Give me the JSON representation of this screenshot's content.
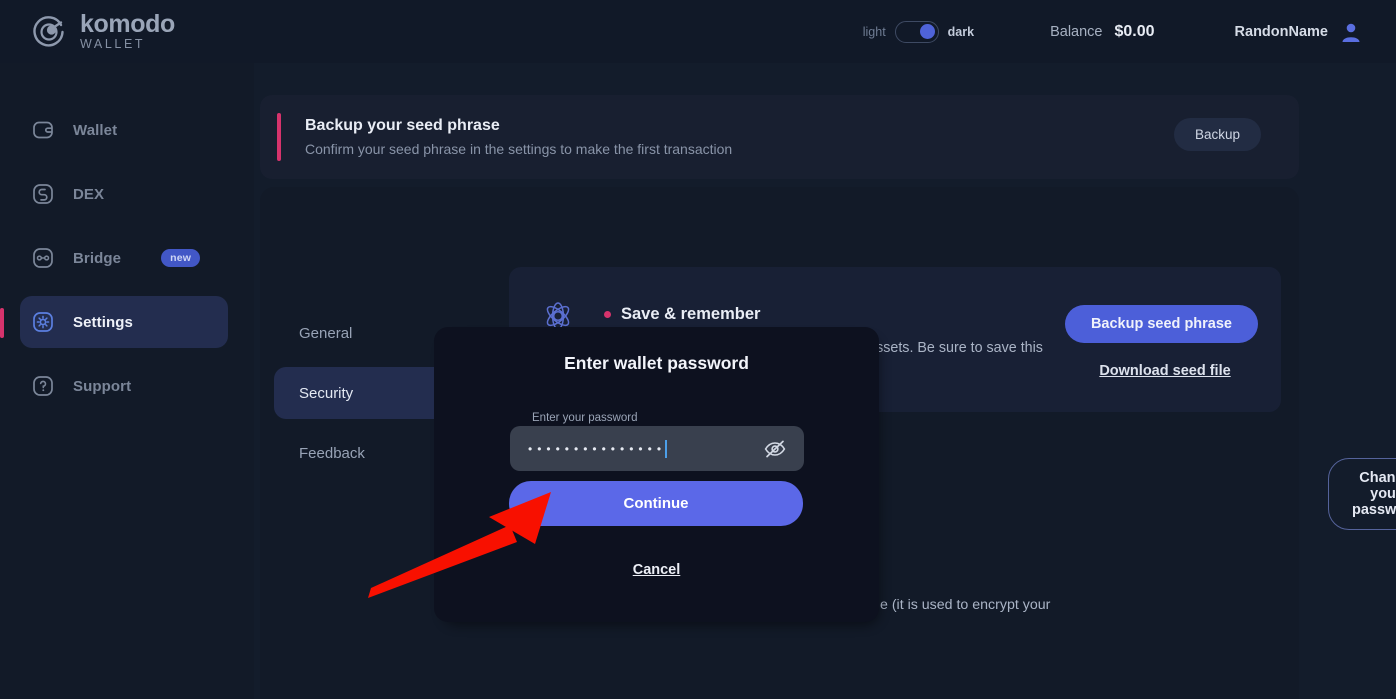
{
  "header": {
    "logo_name": "komodo",
    "logo_sub": "WALLET",
    "theme": {
      "light_label": "light",
      "dark_label": "dark",
      "active": "dark"
    },
    "balance_label": "Balance",
    "balance_value": "$0.00",
    "user_name": "RandonName"
  },
  "sidebar": {
    "items": [
      {
        "label": "Wallet",
        "icon": "wallet-icon",
        "active": false,
        "badge": ""
      },
      {
        "label": "DEX",
        "icon": "swap-icon",
        "active": false,
        "badge": ""
      },
      {
        "label": "Bridge",
        "icon": "bridge-icon",
        "active": false,
        "badge": "new"
      },
      {
        "label": "Settings",
        "icon": "gear-icon",
        "active": true,
        "badge": ""
      },
      {
        "label": "Support",
        "icon": "question-icon",
        "active": false,
        "badge": ""
      }
    ]
  },
  "banner": {
    "title": "Backup your seed phrase",
    "subtitle": "Confirm your seed phrase in the settings to make the first transaction",
    "button": "Backup"
  },
  "settings_nav": {
    "items": [
      {
        "label": "General",
        "active": false
      },
      {
        "label": "Security",
        "active": true
      },
      {
        "label": "Feedback",
        "active": false
      }
    ]
  },
  "seed_card": {
    "title": "Save & remember",
    "body": "Your seed phrase is how you unlock your assets. Be sure to save this securely, and do not share it with anyone!",
    "primary_button": "Backup seed phrase",
    "link": "Download seed file"
  },
  "password_row": {
    "partial_text": "e (it is used to encrypt your",
    "button": "Change your password"
  },
  "modal": {
    "title": "Enter wallet password",
    "field_label": "Enter your password",
    "field_value": "•••••••••••••••",
    "field_placeholder": "Enter your password",
    "eye_icon": "eye-off-icon",
    "continue_button": "Continue",
    "cancel_link": "Cancel"
  },
  "annotation": {
    "arrow_color": "#f81000",
    "points_to": "continue-button"
  },
  "colors": {
    "page_bg": "#131c2b",
    "panel_bg": "#121a28",
    "card_bg": "#182035",
    "accent_blue": "#4c5fd9",
    "accent_pink": "#d6336c",
    "modal_bg": "#0d111f"
  }
}
